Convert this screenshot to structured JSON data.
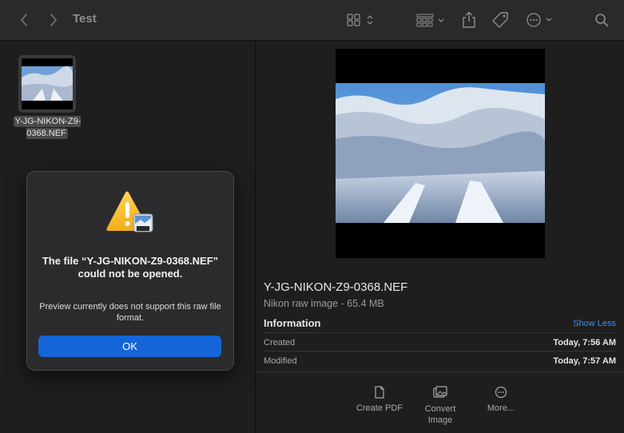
{
  "window": {
    "title": "Test"
  },
  "toolbar": {
    "back_icon": "chevron-left-icon",
    "forward_icon": "chevron-right-icon",
    "view_icon": "grid-view-icon",
    "group_icon": "group-icon",
    "share_icon": "share-icon",
    "tag_icon": "tag-icon",
    "more_icon": "ellipsis-circle-icon",
    "search_icon": "search-icon"
  },
  "files": [
    {
      "name": "Y-JG-NIKON-Z9-0368.NEF"
    }
  ],
  "preview": {
    "file_name": "Y-JG-NIKON-Z9-0368.NEF",
    "kind_size": "Nikon raw image - 65.4 MB",
    "info_heading": "Information",
    "show_less": "Show Less",
    "rows": [
      {
        "key": "Created",
        "value": "Today, 7:56 AM"
      },
      {
        "key": "Modified",
        "value": "Today, 7:57 AM"
      }
    ],
    "quick_actions": [
      {
        "label": "Create PDF",
        "icon": "document-icon"
      },
      {
        "label": "Convert Image",
        "icon": "photos-icon"
      },
      {
        "label": "More...",
        "icon": "ellipsis-circle-icon"
      }
    ]
  },
  "alert": {
    "title": "The file “Y-JG-NIKON-Z9-0368.NEF” could not be opened.",
    "message": "Preview currently does not support this raw file format.",
    "ok_label": "OK",
    "icon": "warning-icon"
  },
  "colors": {
    "accent": "#1466d8",
    "link": "#3b8ef0",
    "window_bg": "#1e1e1f",
    "toolbar_bg": "#2a2a2b"
  }
}
